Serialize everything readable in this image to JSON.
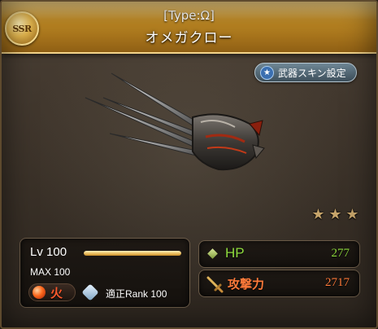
{
  "header": {
    "rarity_badge": "SSR",
    "type_label": "[Type:Ω]",
    "weapon_name": "オメガクロー"
  },
  "skin_button": {
    "label": "武器スキン設定",
    "icon": "star-icon"
  },
  "weapon_image": {
    "icon": "claw-weapon-art"
  },
  "uncap": {
    "stars_filled": 3,
    "stars_total": 3,
    "star_glyph": "★"
  },
  "level": {
    "label": "Lv 100",
    "max_label": "MAX 100",
    "progress": 1.0
  },
  "element": {
    "label": "火",
    "color": "#ff5a2d",
    "icon": "fire-orb-icon"
  },
  "proficiency": {
    "icon": "crystal-icon",
    "label": "適正Rank 100"
  },
  "stats": {
    "hp_label": "HP",
    "hp_value": "277",
    "hp_color": "#8fdb3e",
    "atk_label": "攻撃力",
    "atk_value": "2717",
    "atk_color": "#ff7a3a"
  },
  "colors": {
    "header_gold": "#b98422",
    "panel_bg": "#1a1511"
  }
}
